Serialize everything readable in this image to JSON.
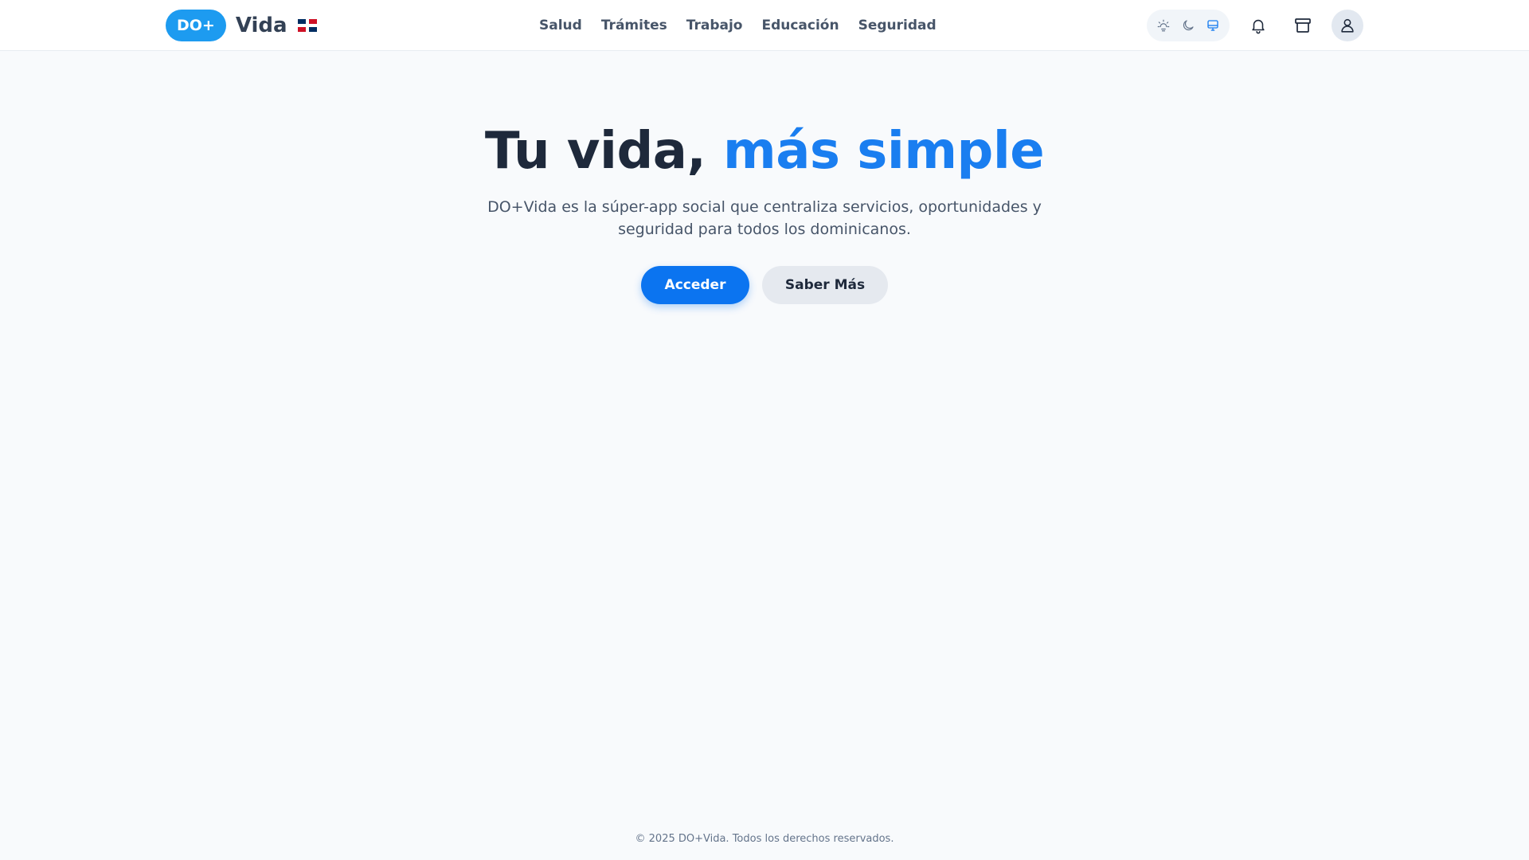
{
  "brand": {
    "badge": "DO+",
    "name": "Vida"
  },
  "nav": {
    "items": [
      {
        "label": "Salud"
      },
      {
        "label": "Trámites"
      },
      {
        "label": "Trabajo"
      },
      {
        "label": "Educación"
      },
      {
        "label": "Seguridad"
      }
    ]
  },
  "theme": {
    "options": [
      "light-icon",
      "dark-icon",
      "system-icon"
    ],
    "selected": "system",
    "accent": "#1a7ef0"
  },
  "header_icons": [
    "bell-icon",
    "box-icon",
    "user-icon"
  ],
  "hero": {
    "title_main": "Tu vida, ",
    "title_accent": "más simple",
    "subtitle": "DO+Vida es la súper-app social que centraliza servicios, oportunidades y seguridad para todos los dominicanos.",
    "primary_button": "Acceder",
    "secondary_button": "Saber Más"
  },
  "footer": {
    "text": "© 2025 DO+Vida. Todos los derechos reservados."
  },
  "colors": {
    "brand_pill": "#1d9bf0",
    "primary": "#0b74f0",
    "background": "#f8fafc"
  }
}
